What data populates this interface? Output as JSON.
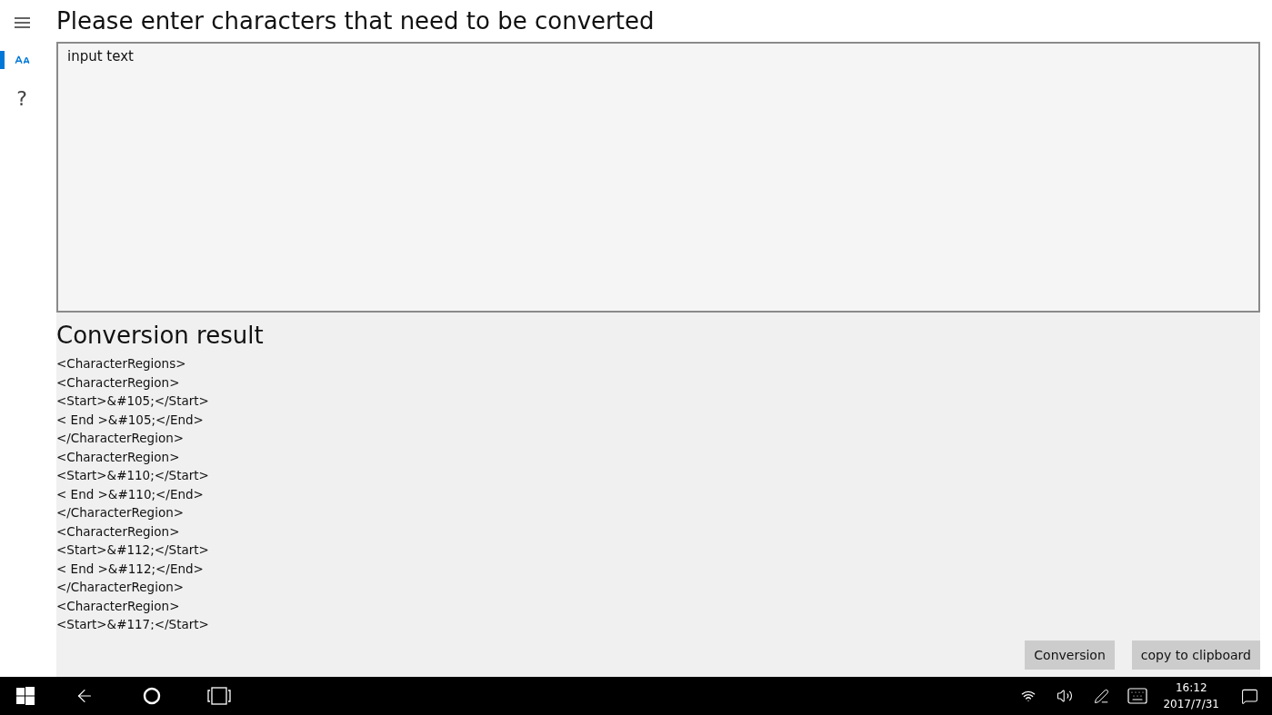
{
  "nav": {
    "items": [
      {
        "kind": "text-size",
        "selected": true
      },
      {
        "kind": "help",
        "label": "?",
        "selected": false
      }
    ]
  },
  "input": {
    "title": "Please enter characters that need to be converted",
    "value": "input text"
  },
  "result": {
    "title": "Conversion result",
    "lines": [
      "<CharacterRegions>",
      "<CharacterRegion>",
      "<Start>&#105;</Start>",
      "< End >&#105;</End>",
      "</CharacterRegion>",
      "<CharacterRegion>",
      "<Start>&#110;</Start>",
      "< End >&#110;</End>",
      "</CharacterRegion>",
      "<CharacterRegion>",
      "<Start>&#112;</Start>",
      "< End >&#112;</End>",
      "</CharacterRegion>",
      "<CharacterRegion>",
      "<Start>&#117;</Start>"
    ]
  },
  "buttons": [
    "Conversion",
    "copy to clipboard"
  ],
  "taskbar": {
    "time": "16:12",
    "date": "2017/7/31"
  }
}
